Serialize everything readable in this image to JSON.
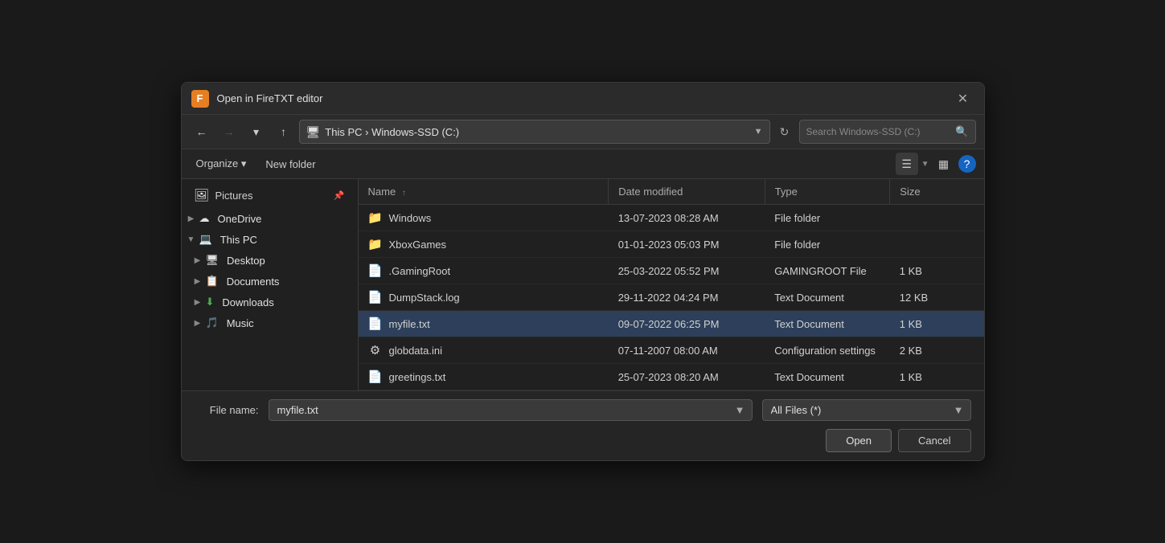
{
  "dialog": {
    "title": "Open in FireTXT editor",
    "icon_label": "F"
  },
  "toolbar": {
    "back_btn": "←",
    "forward_btn": "→",
    "recent_btn": "▾",
    "up_btn": "↑",
    "address_parts": [
      "🖥",
      "This PC",
      "Windows-SSD (C:)"
    ],
    "address_text": "This PC  ›  Windows-SSD (C:)",
    "refresh_btn": "↻",
    "search_placeholder": "Search Windows-SSD (C:)",
    "search_icon": "🔍"
  },
  "command_bar": {
    "organize_label": "Organize ▾",
    "new_folder_label": "New folder",
    "view_list_icon": "☰",
    "view_tiles_icon": "⊞",
    "help_icon": "?"
  },
  "sidebar": {
    "items": [
      {
        "id": "pictures",
        "label": "Pictures",
        "icon": "🖼",
        "pinned": true,
        "indent": 0
      },
      {
        "id": "onedrive",
        "label": "OneDrive",
        "icon": "☁",
        "expanded": false,
        "indent": 0
      },
      {
        "id": "this-pc",
        "label": "This PC",
        "icon": "💻",
        "expanded": true,
        "indent": 0
      },
      {
        "id": "desktop",
        "label": "Desktop",
        "icon": "🖥",
        "expanded": false,
        "indent": 1
      },
      {
        "id": "documents",
        "label": "Documents",
        "icon": "📋",
        "expanded": false,
        "indent": 1
      },
      {
        "id": "downloads",
        "label": "Downloads",
        "icon": "⬇",
        "expanded": false,
        "indent": 1
      },
      {
        "id": "music",
        "label": "Music",
        "icon": "🎵",
        "expanded": false,
        "indent": 1
      }
    ]
  },
  "file_list": {
    "columns": [
      {
        "id": "name",
        "label": "Name",
        "width": "40%"
      },
      {
        "id": "date_modified",
        "label": "Date modified",
        "width": "25%"
      },
      {
        "id": "type",
        "label": "Type",
        "width": "20%"
      },
      {
        "id": "size",
        "label": "Size",
        "width": "15%"
      }
    ],
    "rows": [
      {
        "name": "Windows",
        "icon": "📁",
        "date_modified": "13-07-2023 08:28 AM",
        "type": "File folder",
        "size": "",
        "selected": false
      },
      {
        "name": "XboxGames",
        "icon": "📁",
        "date_modified": "01-01-2023 05:03 PM",
        "type": "File folder",
        "size": "",
        "selected": false
      },
      {
        "name": ".GamingRoot",
        "icon": "📄",
        "date_modified": "25-03-2022 05:52 PM",
        "type": "GAMINGROOT File",
        "size": "1 KB",
        "selected": false
      },
      {
        "name": "DumpStack.log",
        "icon": "📄",
        "date_modified": "29-11-2022 04:24 PM",
        "type": "Text Document",
        "size": "12 KB",
        "selected": false
      },
      {
        "name": "myfile.txt",
        "icon": "📄",
        "date_modified": "09-07-2022 06:25 PM",
        "type": "Text Document",
        "size": "1 KB",
        "selected": true
      },
      {
        "name": "globdata.ini",
        "icon": "⚙",
        "date_modified": "07-11-2007 08:00 AM",
        "type": "Configuration settings",
        "size": "2 KB",
        "selected": false
      },
      {
        "name": "greetings.txt",
        "icon": "📄",
        "date_modified": "25-07-2023 08:20 AM",
        "type": "Text Document",
        "size": "1 KB",
        "selected": false
      }
    ]
  },
  "bottom_bar": {
    "file_name_label": "File name:",
    "file_name_value": "myfile.txt",
    "file_type_label": "All Files (*)",
    "open_btn_label": "Open",
    "cancel_btn_label": "Cancel"
  }
}
